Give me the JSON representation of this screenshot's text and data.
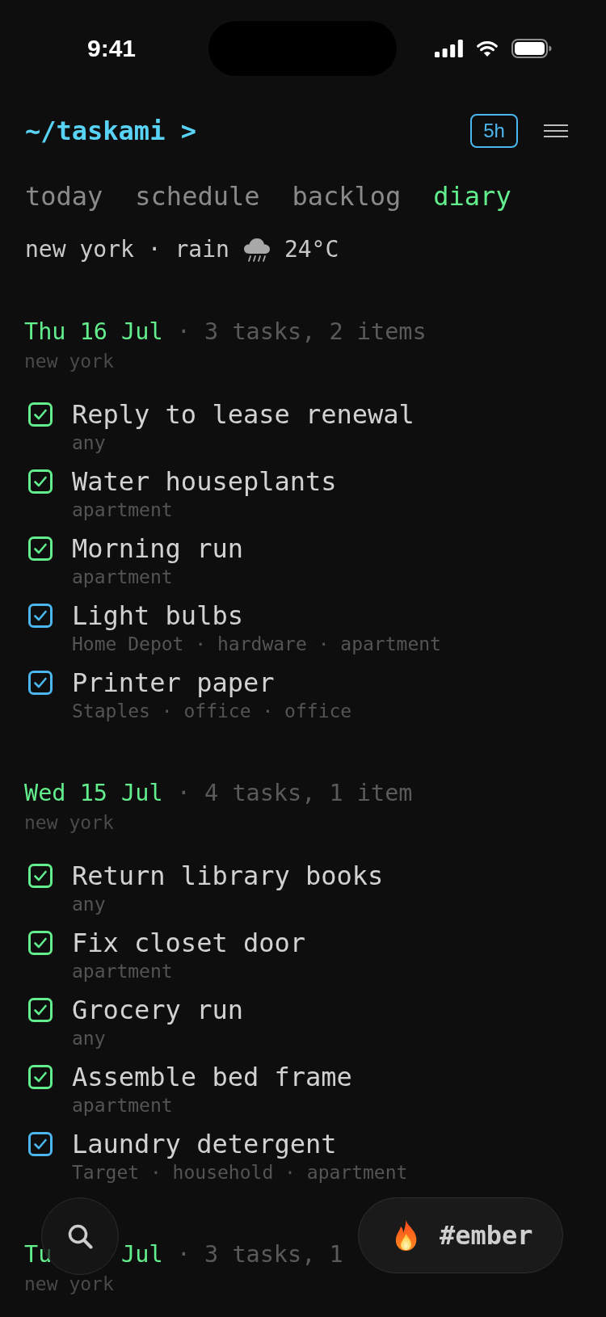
{
  "status_bar": {
    "time": "9:41"
  },
  "header": {
    "title": "~/taskami >",
    "badge": "5h"
  },
  "tabs": [
    {
      "label": "today",
      "selected": false
    },
    {
      "label": "schedule",
      "selected": false
    },
    {
      "label": "backlog",
      "selected": false
    },
    {
      "label": "diary",
      "selected": true
    }
  ],
  "weather": {
    "summary": "new york · rain",
    "temperature": "24°C"
  },
  "sections": [
    {
      "date": "Thu 16 Jul",
      "summary": "· 3 tasks, 2 items",
      "location": "new york",
      "tasks": [
        {
          "title": "Reply to lease renewal",
          "meta": "any",
          "kind": "task",
          "checked": true
        },
        {
          "title": "Water houseplants",
          "meta": "apartment",
          "kind": "task",
          "checked": true
        },
        {
          "title": "Morning run",
          "meta": "apartment",
          "kind": "task",
          "checked": true
        },
        {
          "title": "Light bulbs",
          "meta": "Home Depot · hardware · apartment",
          "kind": "item",
          "checked": true
        },
        {
          "title": "Printer paper",
          "meta": "Staples · office · office",
          "kind": "item",
          "checked": true
        }
      ]
    },
    {
      "date": "Wed 15 Jul",
      "summary": "· 4 tasks, 1 item",
      "location": "new york",
      "tasks": [
        {
          "title": "Return library books",
          "meta": "any",
          "kind": "task",
          "checked": true
        },
        {
          "title": "Fix closet door",
          "meta": "apartment",
          "kind": "task",
          "checked": true
        },
        {
          "title": "Grocery run",
          "meta": "any",
          "kind": "task",
          "checked": true
        },
        {
          "title": "Assemble bed frame",
          "meta": "apartment",
          "kind": "task",
          "checked": true
        },
        {
          "title": "Laundry detergent",
          "meta": "Target · household · apartment",
          "kind": "item",
          "checked": true
        }
      ]
    },
    {
      "date_parts": [
        "Tu",
        "Jul"
      ],
      "summary": "· 3 tasks, 1",
      "location": "new york"
    }
  ],
  "floating": {
    "tag": "#ember"
  }
}
